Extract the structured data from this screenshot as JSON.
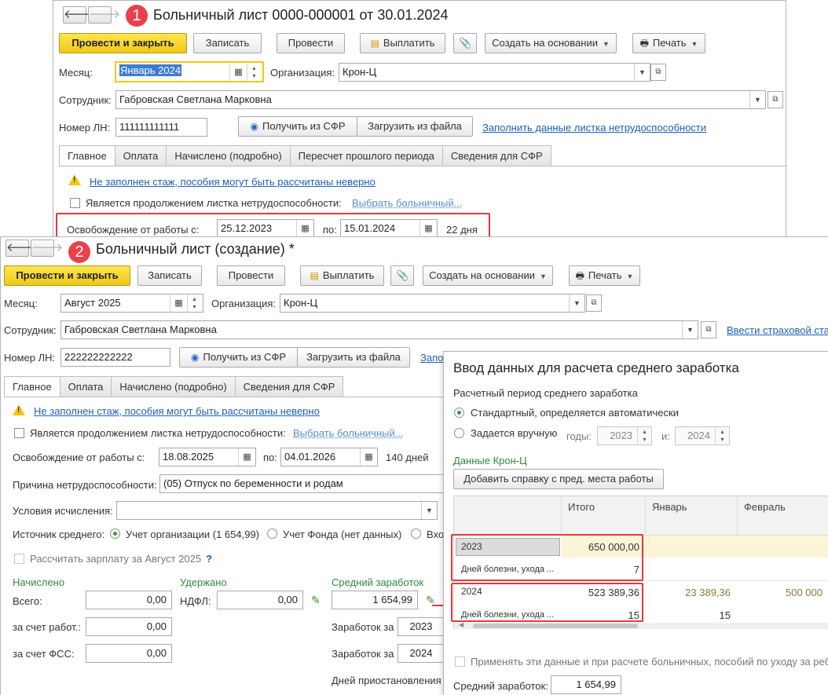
{
  "window1": {
    "badge": "1",
    "title": "Больничный лист 0000-000001 от 30.01.2024",
    "nav": {
      "back": "🡐",
      "forward": "🡒"
    },
    "toolbar": {
      "post_close": "Провести и закрыть",
      "save": "Записать",
      "post": "Провести",
      "pay": "Выплатить",
      "attach": "📎",
      "create_based": "Создать на основании",
      "print": "Печать"
    },
    "month_label": "Месяц:",
    "month_value": "Январь 2024",
    "org_label": "Организация:",
    "org_value": "Крон-Ц",
    "employee_label": "Сотрудник:",
    "employee_value": "Габровская Светлана Марковна",
    "ln_label": "Номер ЛН:",
    "ln_value": "111111111111",
    "get_sfr": "Получить из СФР",
    "load_file": "Загрузить из файла",
    "fill_link": "Заполнить данные листка нетрудоспособности",
    "tabs": [
      "Главное",
      "Оплата",
      "Начислено (подробно)",
      "Пересчет прошлого периода",
      "Сведения для СФР"
    ],
    "warning": "Не заполнен стаж, пособия могут быть рассчитаны неверно",
    "continuation_label": "Является продолжением листка нетрудоспособности:",
    "choose_sick": "Выбрать больничный...",
    "release_label": "Освобождение от работы с:",
    "date_from": "25.12.2023",
    "to_label": "по:",
    "date_to": "15.01.2024",
    "days": "22 дня"
  },
  "window2": {
    "badge": "2",
    "title": "Больничный лист (создание) *",
    "toolbar": {
      "post_close": "Провести и закрыть",
      "save": "Записать",
      "post": "Провести",
      "pay": "Выплатить",
      "attach": "📎",
      "create_based": "Создать на основании",
      "print": "Печать"
    },
    "month_label": "Месяц:",
    "month_value": "Август 2025",
    "org_label": "Организация:",
    "org_value": "Крон-Ц",
    "employee_label": "Сотрудник:",
    "employee_value": "Габровская Светлана Марковна",
    "insurance_link": "Ввести страховой ста",
    "ln_label": "Номер ЛН:",
    "ln_value": "222222222222",
    "get_sfr": "Получить из СФР",
    "load_file": "Загрузить из файла",
    "fill_link": "Запо",
    "tabs": [
      "Главное",
      "Оплата",
      "Начислено (подробно)",
      "Сведения для СФР"
    ],
    "warning": "Не заполнен стаж, пособия могут быть рассчитаны неверно",
    "continuation_label": "Является продолжением листка нетрудоспособности:",
    "choose_sick": "Выбрать больничный...",
    "release_label": "Освобождение от работы с:",
    "date_from": "18.08.2025",
    "to_label": "по:",
    "date_to": "04.01.2026",
    "days": "140 дней",
    "reason_label": "Причина нетрудоспособности:",
    "reason_value": "(05) Отпуск по беременности и родам",
    "conditions_label": "Условия исчисления:",
    "source_label": "Источник среднего:",
    "source_org": "Учет организации (1 654,99)",
    "source_fund": "Учет Фонда (нет данных)",
    "source_other": "Вхо",
    "calc_salary": "Рассчитать зарплату за Август 2025",
    "help": "?",
    "accrued_header": "Начислено",
    "withheld_header": "Удержано",
    "avg_header": "Средний заработок",
    "total_label": "Всего:",
    "total_value": "0,00",
    "ndfl_label": "НДФЛ:",
    "ndfl_value": "0,00",
    "avg_value": "1 654,99",
    "employer_label": "за счет работ.:",
    "employer_value": "0,00",
    "fss_label": "за счет ФСС:",
    "fss_value": "0,00",
    "earnings_label_1": "Заработок за",
    "earnings_year_1": "2023",
    "earnings_label_2": "Заработок за",
    "earnings_year_2": "2024",
    "suspension_label": "Дней приостановления"
  },
  "dialog": {
    "title": "Ввод данных для расчета среднего заработка",
    "period_label": "Расчетный период среднего заработка",
    "standard": "Стандартный, определяется автоматически",
    "manual": "Задается вручную",
    "years_label": "годы:",
    "year_from": "2023",
    "and_label": "и:",
    "year_to": "2024",
    "org_data": "Данные Крон-Ц",
    "add_ref": "Добавить справку с пред. места работы",
    "cols": [
      "Итого",
      "Январь",
      "Февраль"
    ],
    "rows": [
      {
        "year": "2023",
        "total": "650 000,00",
        "jan": "",
        "feb": "",
        "days_label": "Дней болезни, ухода ...",
        "days_total": "7",
        "days_jan": ""
      },
      {
        "year": "2024",
        "total": "523 389,36",
        "jan": "23 389,36",
        "feb": "500 000",
        "days_label": "Дней болезни, ухода ...",
        "days_total": "15",
        "days_jan": "15"
      }
    ],
    "apply_label": "Применять эти данные и при расчете больничных, пособий по уходу за реб",
    "avg_label": "Средний заработок:",
    "avg_value": "1 654,99"
  }
}
